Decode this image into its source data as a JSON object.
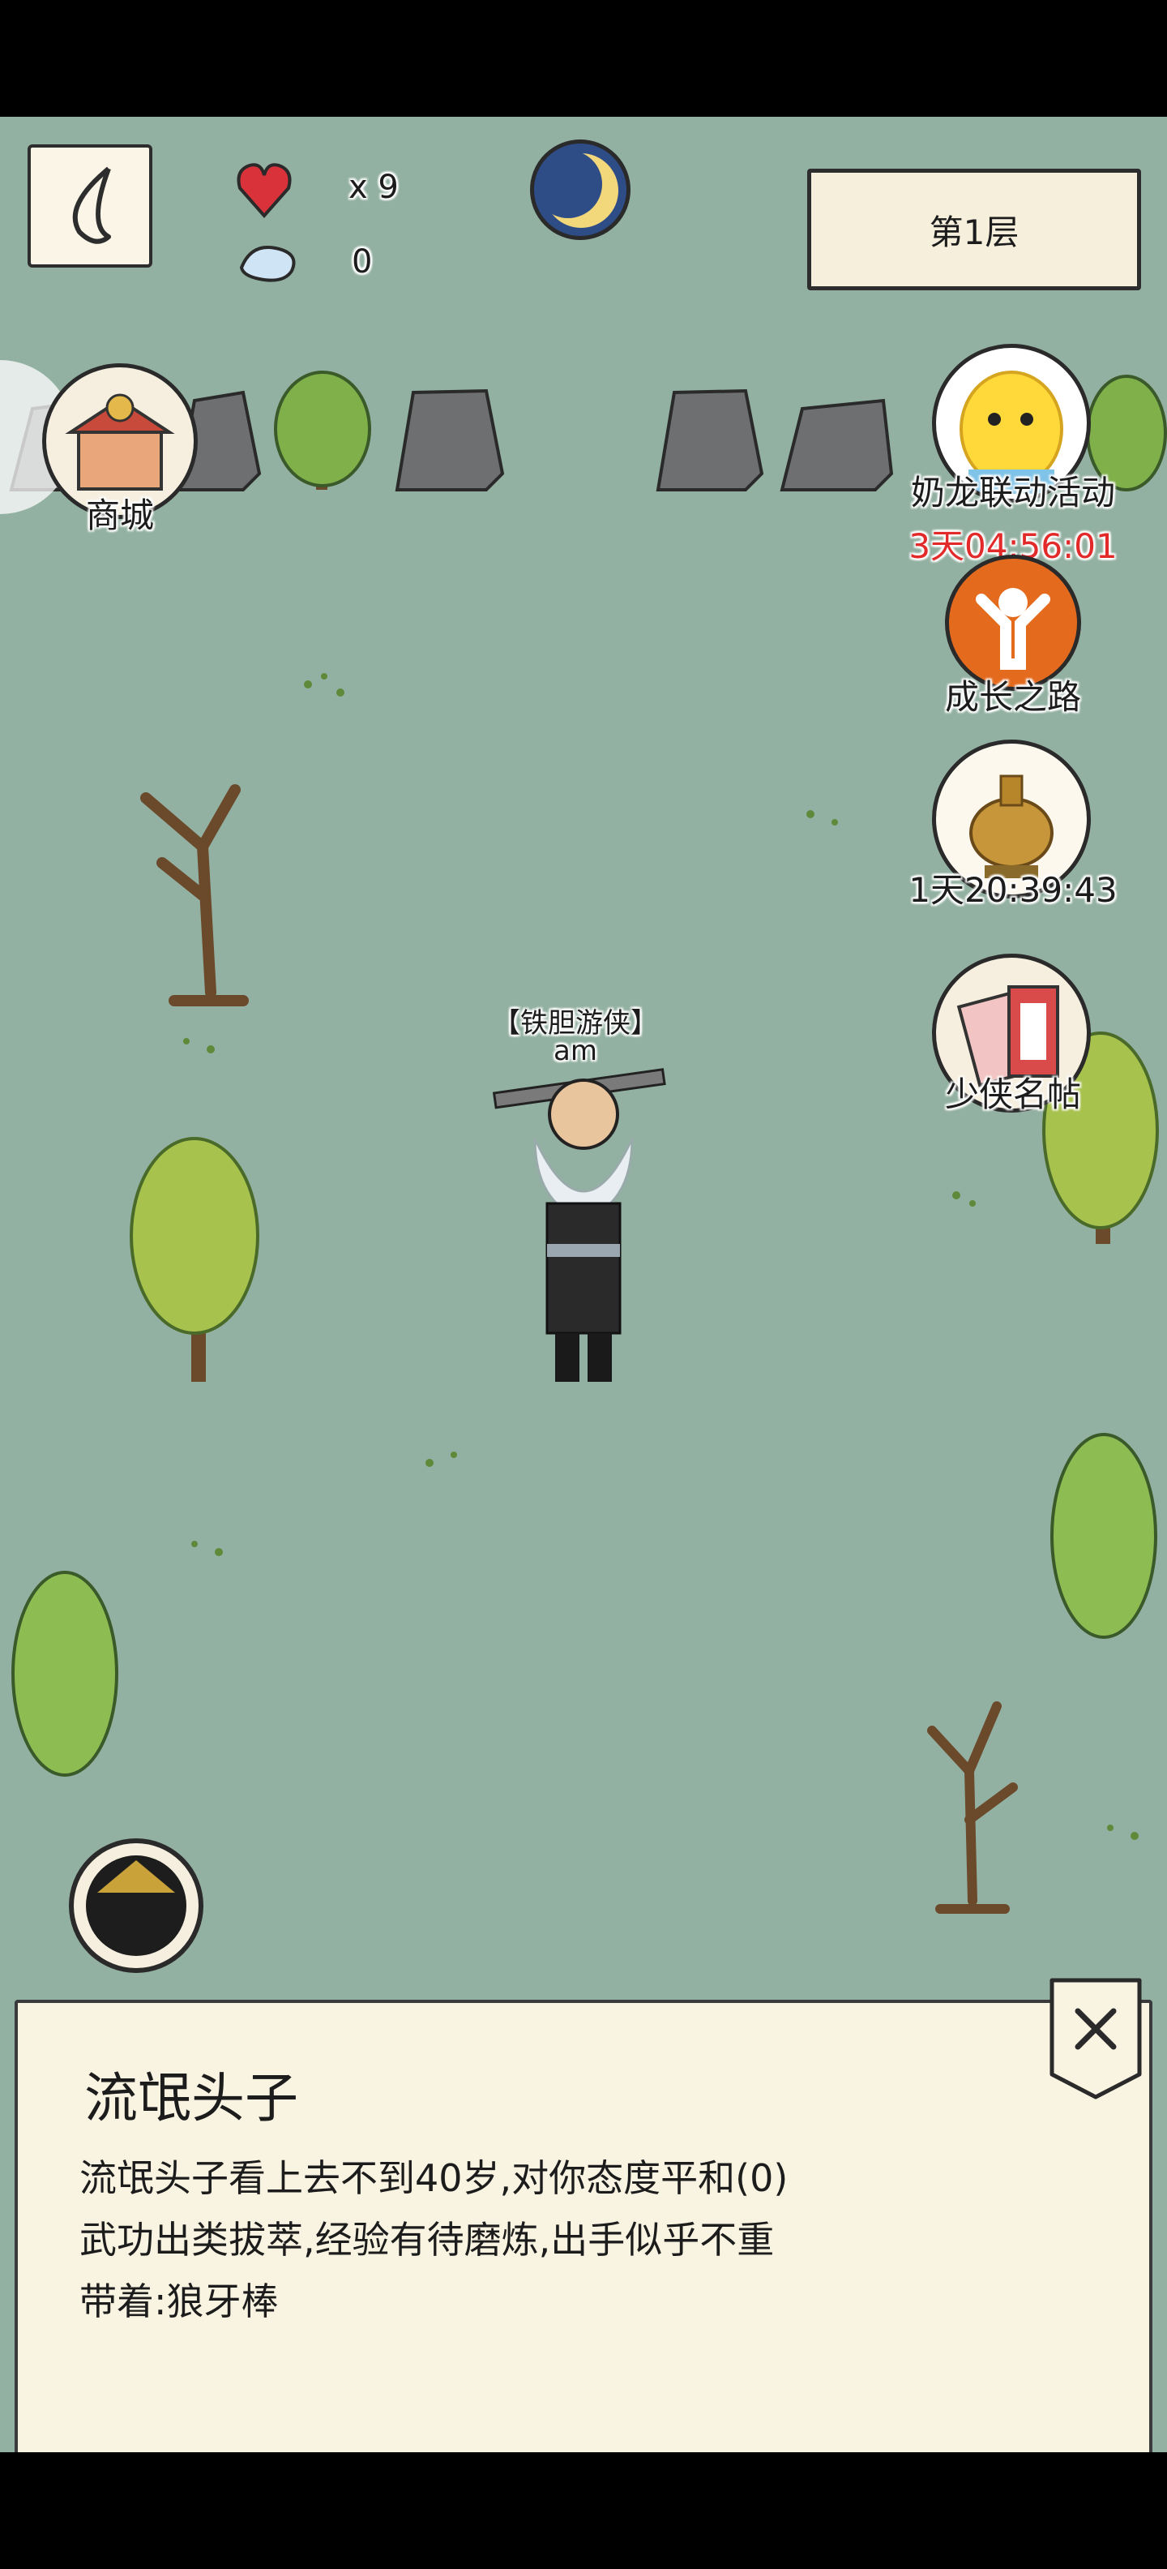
{
  "colors": {
    "grass": "#93b1a2",
    "panel": "#f9f3e2",
    "timer_red": "#e22a2a",
    "ink": "#1c1c1c"
  },
  "hud": {
    "back_icon": "back-arrow-icon",
    "hearts_count": "x 9",
    "spirit_count": "0",
    "moon_icon": "crescent-moon-icon",
    "floor_label": "第1层"
  },
  "side_buttons": {
    "shop": {
      "label": "商城",
      "icon": "shop-stall-icon"
    },
    "collab_event": {
      "label": "奶龙联动活动",
      "timer": "3天04:56:01",
      "icon": "nailong-mascot-icon"
    },
    "growth_path": {
      "label": "成长之路",
      "icon": "growth-figure-icon"
    },
    "treasure_event": {
      "timer": "1天20:39:43",
      "icon": "golden-censer-icon"
    },
    "hero_roster": {
      "label": "少侠名帖",
      "icon": "name-card-icon"
    }
  },
  "player": {
    "title": "【铁胆游侠】",
    "name": "am"
  },
  "npc_panel": {
    "name": "流氓头子",
    "line1": "流氓头子看上去不到40岁,对你态度平和(0)",
    "line2": "武功出类拔萃,经验有待磨炼,出手似乎不重",
    "line3": "带着:狼牙棒",
    "close_icon": "close-icon"
  }
}
